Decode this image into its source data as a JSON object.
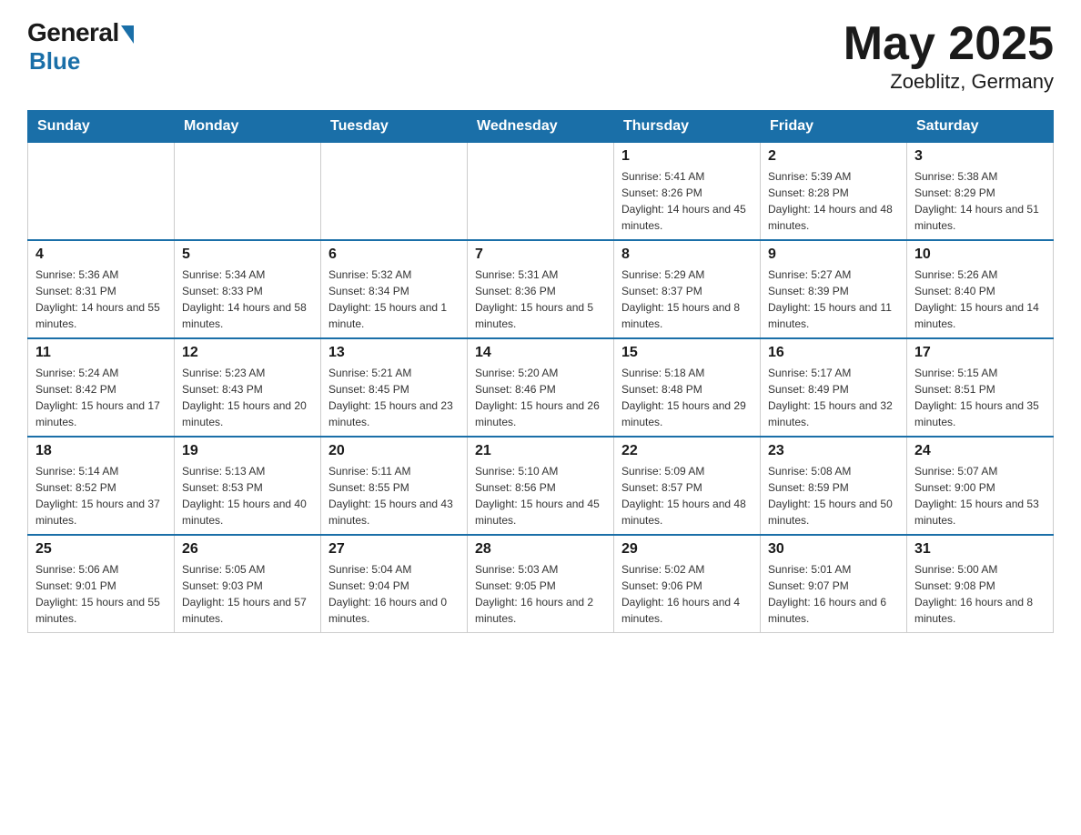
{
  "header": {
    "logo_general": "General",
    "logo_blue": "Blue",
    "title": "May 2025",
    "subtitle": "Zoeblitz, Germany"
  },
  "weekdays": [
    "Sunday",
    "Monday",
    "Tuesday",
    "Wednesday",
    "Thursday",
    "Friday",
    "Saturday"
  ],
  "weeks": [
    [
      {
        "day": "",
        "info": ""
      },
      {
        "day": "",
        "info": ""
      },
      {
        "day": "",
        "info": ""
      },
      {
        "day": "",
        "info": ""
      },
      {
        "day": "1",
        "info": "Sunrise: 5:41 AM\nSunset: 8:26 PM\nDaylight: 14 hours and 45 minutes."
      },
      {
        "day": "2",
        "info": "Sunrise: 5:39 AM\nSunset: 8:28 PM\nDaylight: 14 hours and 48 minutes."
      },
      {
        "day": "3",
        "info": "Sunrise: 5:38 AM\nSunset: 8:29 PM\nDaylight: 14 hours and 51 minutes."
      }
    ],
    [
      {
        "day": "4",
        "info": "Sunrise: 5:36 AM\nSunset: 8:31 PM\nDaylight: 14 hours and 55 minutes."
      },
      {
        "day": "5",
        "info": "Sunrise: 5:34 AM\nSunset: 8:33 PM\nDaylight: 14 hours and 58 minutes."
      },
      {
        "day": "6",
        "info": "Sunrise: 5:32 AM\nSunset: 8:34 PM\nDaylight: 15 hours and 1 minute."
      },
      {
        "day": "7",
        "info": "Sunrise: 5:31 AM\nSunset: 8:36 PM\nDaylight: 15 hours and 5 minutes."
      },
      {
        "day": "8",
        "info": "Sunrise: 5:29 AM\nSunset: 8:37 PM\nDaylight: 15 hours and 8 minutes."
      },
      {
        "day": "9",
        "info": "Sunrise: 5:27 AM\nSunset: 8:39 PM\nDaylight: 15 hours and 11 minutes."
      },
      {
        "day": "10",
        "info": "Sunrise: 5:26 AM\nSunset: 8:40 PM\nDaylight: 15 hours and 14 minutes."
      }
    ],
    [
      {
        "day": "11",
        "info": "Sunrise: 5:24 AM\nSunset: 8:42 PM\nDaylight: 15 hours and 17 minutes."
      },
      {
        "day": "12",
        "info": "Sunrise: 5:23 AM\nSunset: 8:43 PM\nDaylight: 15 hours and 20 minutes."
      },
      {
        "day": "13",
        "info": "Sunrise: 5:21 AM\nSunset: 8:45 PM\nDaylight: 15 hours and 23 minutes."
      },
      {
        "day": "14",
        "info": "Sunrise: 5:20 AM\nSunset: 8:46 PM\nDaylight: 15 hours and 26 minutes."
      },
      {
        "day": "15",
        "info": "Sunrise: 5:18 AM\nSunset: 8:48 PM\nDaylight: 15 hours and 29 minutes."
      },
      {
        "day": "16",
        "info": "Sunrise: 5:17 AM\nSunset: 8:49 PM\nDaylight: 15 hours and 32 minutes."
      },
      {
        "day": "17",
        "info": "Sunrise: 5:15 AM\nSunset: 8:51 PM\nDaylight: 15 hours and 35 minutes."
      }
    ],
    [
      {
        "day": "18",
        "info": "Sunrise: 5:14 AM\nSunset: 8:52 PM\nDaylight: 15 hours and 37 minutes."
      },
      {
        "day": "19",
        "info": "Sunrise: 5:13 AM\nSunset: 8:53 PM\nDaylight: 15 hours and 40 minutes."
      },
      {
        "day": "20",
        "info": "Sunrise: 5:11 AM\nSunset: 8:55 PM\nDaylight: 15 hours and 43 minutes."
      },
      {
        "day": "21",
        "info": "Sunrise: 5:10 AM\nSunset: 8:56 PM\nDaylight: 15 hours and 45 minutes."
      },
      {
        "day": "22",
        "info": "Sunrise: 5:09 AM\nSunset: 8:57 PM\nDaylight: 15 hours and 48 minutes."
      },
      {
        "day": "23",
        "info": "Sunrise: 5:08 AM\nSunset: 8:59 PM\nDaylight: 15 hours and 50 minutes."
      },
      {
        "day": "24",
        "info": "Sunrise: 5:07 AM\nSunset: 9:00 PM\nDaylight: 15 hours and 53 minutes."
      }
    ],
    [
      {
        "day": "25",
        "info": "Sunrise: 5:06 AM\nSunset: 9:01 PM\nDaylight: 15 hours and 55 minutes."
      },
      {
        "day": "26",
        "info": "Sunrise: 5:05 AM\nSunset: 9:03 PM\nDaylight: 15 hours and 57 minutes."
      },
      {
        "day": "27",
        "info": "Sunrise: 5:04 AM\nSunset: 9:04 PM\nDaylight: 16 hours and 0 minutes."
      },
      {
        "day": "28",
        "info": "Sunrise: 5:03 AM\nSunset: 9:05 PM\nDaylight: 16 hours and 2 minutes."
      },
      {
        "day": "29",
        "info": "Sunrise: 5:02 AM\nSunset: 9:06 PM\nDaylight: 16 hours and 4 minutes."
      },
      {
        "day": "30",
        "info": "Sunrise: 5:01 AM\nSunset: 9:07 PM\nDaylight: 16 hours and 6 minutes."
      },
      {
        "day": "31",
        "info": "Sunrise: 5:00 AM\nSunset: 9:08 PM\nDaylight: 16 hours and 8 minutes."
      }
    ]
  ]
}
